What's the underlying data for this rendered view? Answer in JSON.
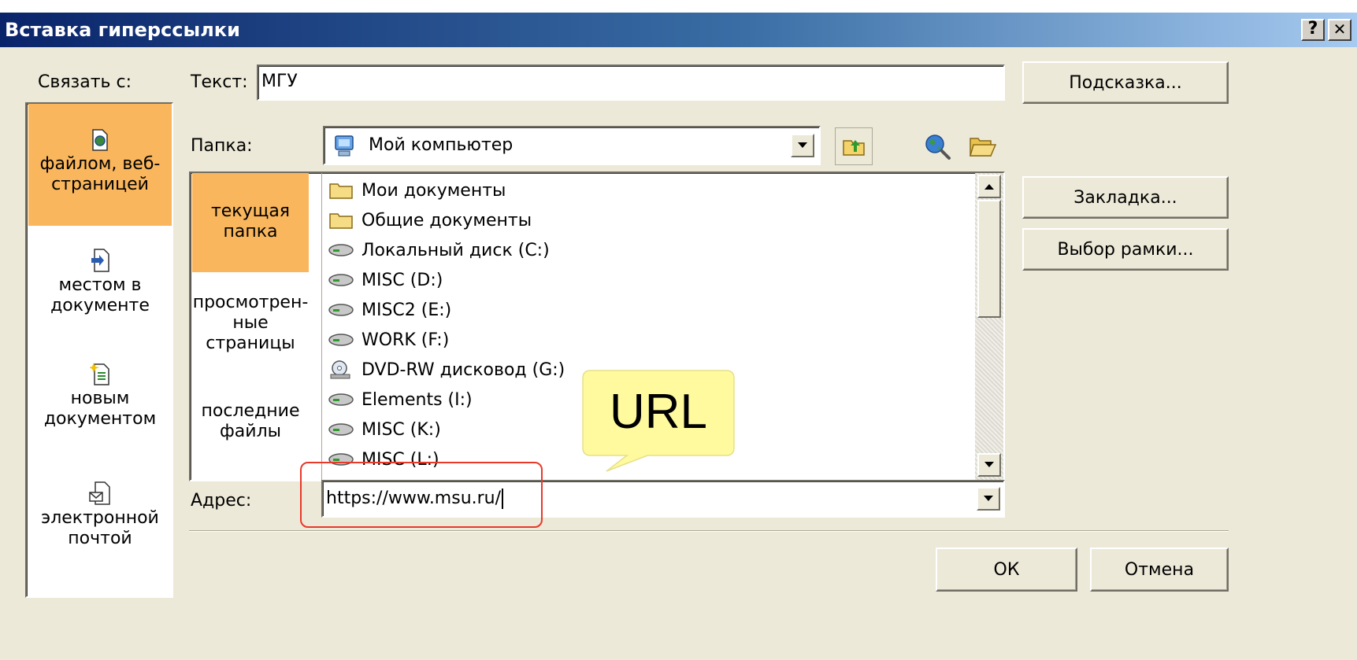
{
  "title": "Вставка гиперссылки",
  "title_buttons": {
    "help": "?",
    "close": "✕"
  },
  "link_to": {
    "label": "Связать с:",
    "items": [
      {
        "label_top": "файлом, веб-",
        "label_bottom": "страницей",
        "icon": "web-file-icon",
        "selected": true
      },
      {
        "label_top": "местом в",
        "label_bottom": "документе",
        "icon": "document-place-icon",
        "selected": false
      },
      {
        "label_top": "новым",
        "label_bottom": "документом",
        "icon": "new-document-icon",
        "selected": false
      },
      {
        "label_top": "электронной",
        "label_bottom": "почтой",
        "icon": "email-icon",
        "selected": false
      }
    ]
  },
  "text_field": {
    "label": "Текст:",
    "value": "МГУ"
  },
  "hint_button": "Подсказка...",
  "folder": {
    "label": "Папка:",
    "value": "Мой компьютер",
    "icon": "my-computer-icon"
  },
  "lookin": [
    {
      "line1": "текущая",
      "line2": "папка",
      "selected": true
    },
    {
      "line1": "просмотрен-",
      "line2": "ные",
      "line3": "страницы",
      "selected": false
    },
    {
      "line1": "последние",
      "line2": "файлы",
      "selected": false
    }
  ],
  "files": [
    {
      "name": "Мои документы",
      "icon": "folder-icon"
    },
    {
      "name": "Общие документы",
      "icon": "folder-icon"
    },
    {
      "name": "Локальный диск (C:)",
      "icon": "hard-drive-icon"
    },
    {
      "name": "MISC (D:)",
      "icon": "hard-drive-icon"
    },
    {
      "name": "MISC2 (E:)",
      "icon": "hard-drive-icon"
    },
    {
      "name": "WORK (F:)",
      "icon": "hard-drive-icon"
    },
    {
      "name": "DVD-RW дисковод (G:)",
      "icon": "dvd-drive-icon"
    },
    {
      "name": "Elements (I:)",
      "icon": "hard-drive-icon"
    },
    {
      "name": "MISC (K:)",
      "icon": "hard-drive-icon"
    },
    {
      "name": "MISC (L:)",
      "icon": "hard-drive-icon"
    }
  ],
  "bookmark_button": "Закладка...",
  "frame_button": "Выбор рамки...",
  "address": {
    "label": "Адрес:",
    "value": "https://www.msu.ru/"
  },
  "ok_button": "ОК",
  "cancel_button": "Отмена",
  "callout": {
    "text": "URL"
  },
  "colors": {
    "selected": "#f9b65c",
    "dialog_bg": "#ece9d8",
    "callout_bg": "#fffa9e",
    "highlight_border": "#e8392a"
  }
}
